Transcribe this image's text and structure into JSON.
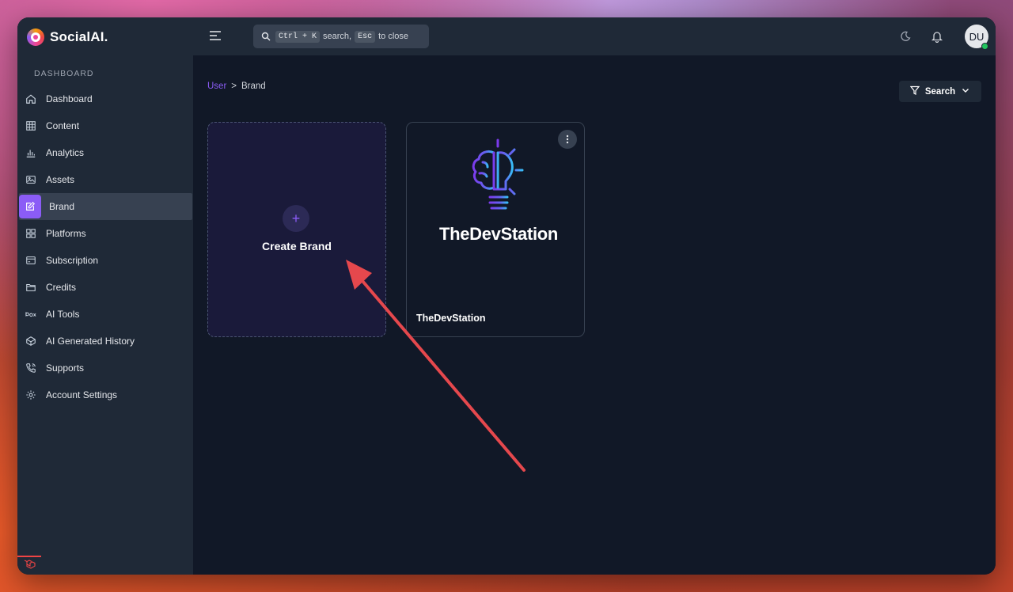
{
  "app": {
    "name": "SocialAI."
  },
  "sidebar": {
    "section_label": "DASHBOARD",
    "items": [
      {
        "label": "Dashboard",
        "icon": "home-icon"
      },
      {
        "label": "Content",
        "icon": "grid-icon"
      },
      {
        "label": "Analytics",
        "icon": "bar-chart-icon"
      },
      {
        "label": "Assets",
        "icon": "image-icon"
      },
      {
        "label": "Brand",
        "icon": "edit-icon",
        "active": true
      },
      {
        "label": "Platforms",
        "icon": "apps-icon"
      },
      {
        "label": "Subscription",
        "icon": "credit-card-icon"
      },
      {
        "label": "Credits",
        "icon": "folder-icon"
      },
      {
        "label": "AI Tools",
        "icon": "box-icon"
      },
      {
        "label": "AI Generated History",
        "icon": "cube-icon"
      },
      {
        "label": "Supports",
        "icon": "phone-icon"
      },
      {
        "label": "Account Settings",
        "icon": "gear-icon"
      }
    ]
  },
  "topbar": {
    "search": {
      "kbd_1": "Ctrl + K",
      "text_1": "search,",
      "kbd_2": "Esc",
      "text_2": "to close"
    },
    "avatar_initials": "DU"
  },
  "breadcrumb": {
    "parent": "User",
    "separator": ">",
    "current": "Brand"
  },
  "filter": {
    "label": "Search"
  },
  "cards": {
    "create": {
      "icon_text": "+",
      "label": "Create Brand"
    },
    "brand": {
      "logo_text": "TheDevStation",
      "name": "TheDevStation"
    }
  },
  "colors": {
    "accent": "#8b5cf6",
    "sidebar_bg": "#1f2937",
    "main_bg": "#111827",
    "annotation_arrow": "#e5484d"
  }
}
